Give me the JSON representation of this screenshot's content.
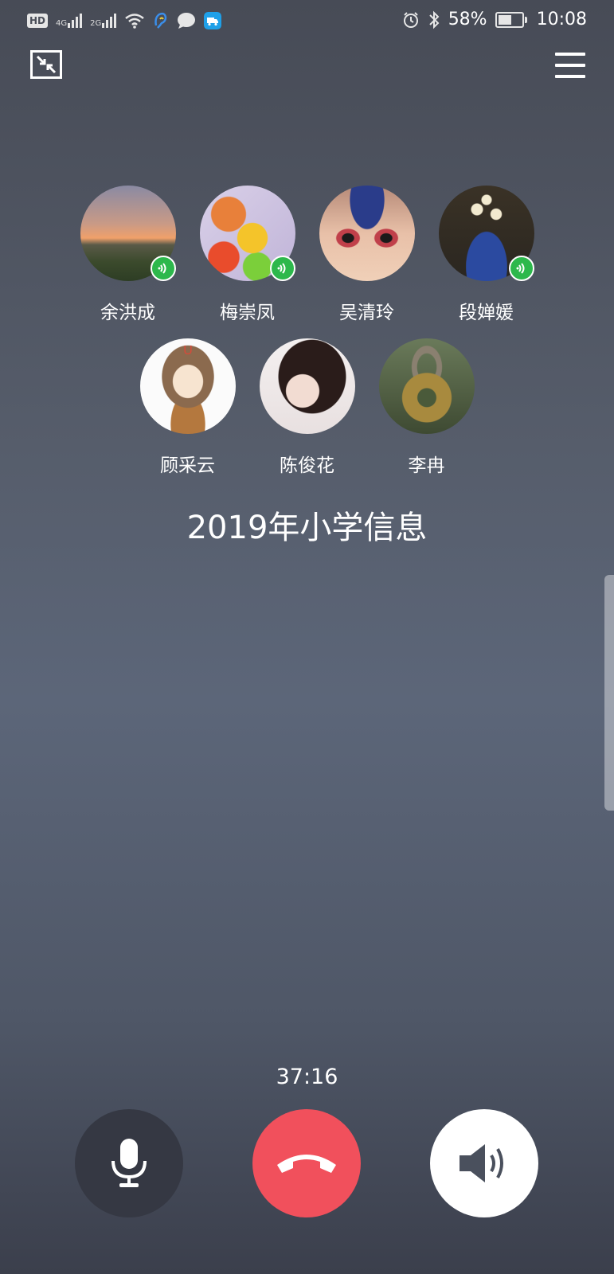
{
  "status_bar": {
    "hd": "HD",
    "net1": "4G",
    "net2": "2G",
    "battery_pct": "58%",
    "battery_level": 0.58,
    "time": "10:08"
  },
  "members": [
    {
      "name": "余洪成",
      "speaking": true
    },
    {
      "name": "梅崇凤",
      "speaking": true
    },
    {
      "name": "吴清玲",
      "speaking": false
    },
    {
      "name": "段婵媛",
      "speaking": true
    },
    {
      "name": "顾采云",
      "speaking": false
    },
    {
      "name": "陈俊花",
      "speaking": false
    },
    {
      "name": "李冉",
      "speaking": false
    }
  ],
  "group": {
    "title": "2019年小学信息"
  },
  "call": {
    "duration": "37:16"
  },
  "colors": {
    "speaking": "#2db84c",
    "hangup": "#f1505c",
    "mic_bg": "#353843",
    "speaker_bg": "#ffffff"
  }
}
